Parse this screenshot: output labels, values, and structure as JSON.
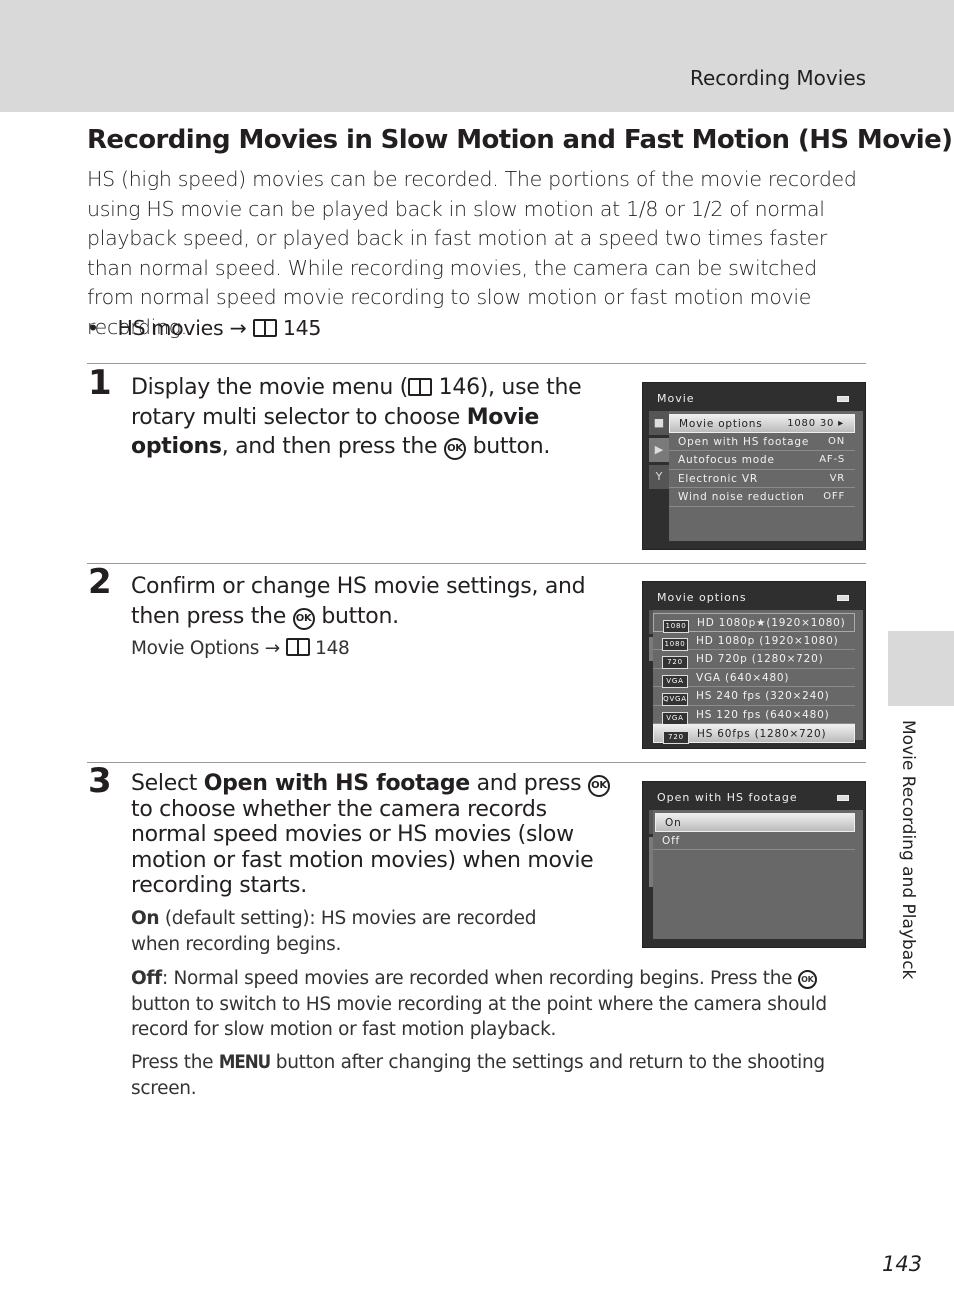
{
  "header": {
    "section": "Recording Movies"
  },
  "title": "Recording Movies in Slow Motion and Fast Motion (HS Movie)",
  "intro": "HS (high speed) movies can be recorded. The portions of the movie recorded using HS movie can be played back in slow motion at 1/8 or 1/2 of normal playback speed, or played back in fast motion at a speed two times faster than normal speed. While recording movies, the camera can be switched from normal speed movie recording to slow motion or fast motion movie recording.",
  "bullet": {
    "text": "HS movies",
    "arrow": "→",
    "page": "145"
  },
  "steps": [
    {
      "number": "1",
      "t1": "Display the movie menu (",
      "page": "146",
      "t2": "), use the rotary multi selector to choose ",
      "b1": "Movie options",
      "t3": ", and then press the ",
      "t4": " button."
    },
    {
      "number": "2",
      "t1": "Confirm or change HS movie settings, and then press the ",
      "t2": " button.",
      "ref": "Movie Options",
      "arrow": "→",
      "page": "148"
    },
    {
      "number": "3",
      "t1": "Select ",
      "b1": "Open with HS footage",
      "t2": " and press ",
      "t3": " to choose whether the camera records normal speed movies or HS movies (slow motion or fast motion movies) when movie recording starts.",
      "on_label": "On",
      "on_text": " (default setting): HS movies are recorded when recording begins.",
      "off_label": "Off",
      "off_text1": ": Normal speed movies are recorded when recording begins. Press the ",
      "off_text2": " button to switch to HS movie recording at the point where the camera should record for slow motion or fast motion playback.",
      "press1": "Press the ",
      "menu": "MENU",
      "press2": " button after changing the settings and return to the shooting screen."
    }
  ],
  "ok_glyph": "OK",
  "screen1": {
    "title": "Movie",
    "items": [
      {
        "label": "Movie options",
        "value": "1080 30 ▸"
      },
      {
        "label": "Open with HS footage",
        "value": "ON"
      },
      {
        "label": "Autofocus mode",
        "value": "AF-S"
      },
      {
        "label": "Electronic VR",
        "value": "VR"
      },
      {
        "label": "Wind noise reduction",
        "value": "OFF"
      }
    ]
  },
  "screen2": {
    "title": "Movie options",
    "items": [
      {
        "icon": "1080",
        "label": "HD 1080p★(1920×1080)"
      },
      {
        "icon": "1080",
        "label": "HD 1080p (1920×1080)"
      },
      {
        "icon": "720",
        "label": "HD 720p (1280×720)"
      },
      {
        "icon": "VGA",
        "label": "VGA (640×480)"
      },
      {
        "icon": "QVGA",
        "label": "HS 240 fps (320×240)"
      },
      {
        "icon": "VGA",
        "label": "HS 120 fps (640×480)"
      },
      {
        "icon": "720",
        "label": "HS 60fps (1280×720)"
      }
    ]
  },
  "screen3": {
    "title": "Open with HS footage",
    "items": [
      {
        "label": "On"
      },
      {
        "label": "Off"
      }
    ]
  },
  "side_tab": "Movie Recording and Playback",
  "page_number": "143"
}
